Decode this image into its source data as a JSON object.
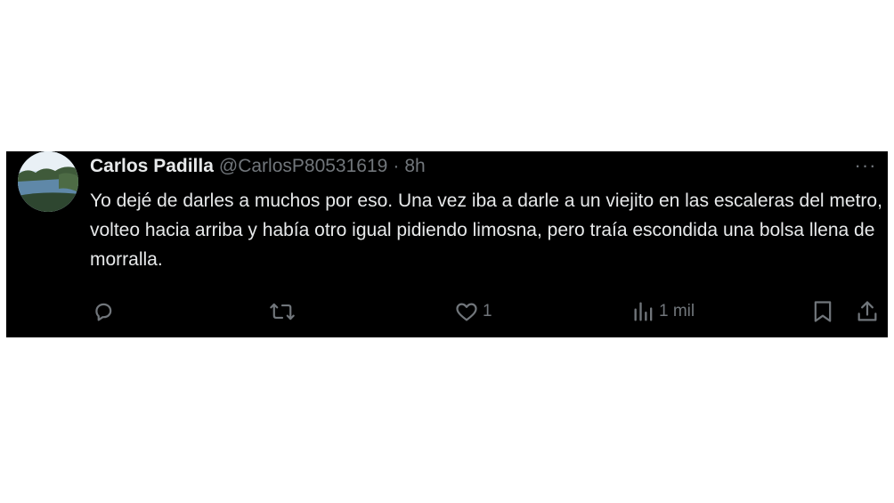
{
  "tweet": {
    "name": "Carlos Padilla",
    "handle": "@CarlosP80531619",
    "separator": "·",
    "time": "8h",
    "text": "Yo dejé de darles a muchos por eso. Una vez iba a darle a un viejito en las escaleras del metro, volteo hacia arriba y había otro igual pidiendo limosna, pero traía escondida una bolsa llena de morralla.",
    "more_label": "···"
  },
  "actions": {
    "likes": "1",
    "views": "1 mil"
  },
  "icons": {
    "reply": "reply-icon",
    "retweet": "retweet-icon",
    "like": "heart-icon",
    "views": "views-icon",
    "bookmark": "bookmark-icon",
    "share": "share-icon"
  },
  "colors": {
    "background": "#000000",
    "text": "#e7e9ea",
    "muted": "#71767b"
  }
}
